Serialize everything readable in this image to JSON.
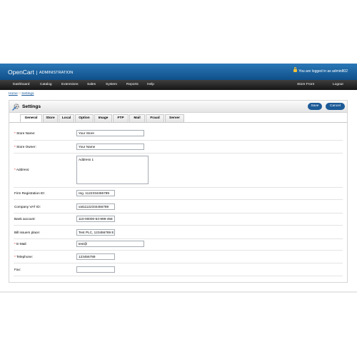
{
  "header": {
    "brand": "OpenCart",
    "subtitle": "ADMINISTRATION",
    "login_text": "You are logged in as admin802"
  },
  "menu": {
    "left": [
      "Dashboard",
      "Catalog",
      "Extensions",
      "Sales",
      "System",
      "Reports",
      "Help"
    ],
    "right": [
      "Store Front",
      "Logout"
    ]
  },
  "breadcrumb": {
    "home": "Home",
    "separator": "::",
    "current": "Settings"
  },
  "panel": {
    "title": "Settings",
    "save_label": "Save",
    "cancel_label": "Cancel"
  },
  "tabs": [
    "General",
    "Store",
    "Local",
    "Option",
    "Image",
    "FTP",
    "Mail",
    "Fraud",
    "Server"
  ],
  "active_tab": "General",
  "fields": [
    {
      "label": "Store Name:",
      "required": true,
      "value": "Your Store"
    },
    {
      "label": "Store Owner:",
      "required": true,
      "value": "Your Name"
    },
    {
      "label": "Address:",
      "required": true,
      "value": "Address 1"
    },
    {
      "label": "Firm Registration ID:",
      "required": false,
      "value": "reg. 1122334455789"
    },
    {
      "label": "Company VAT ID:",
      "required": false,
      "value": "vat11122334456789"
    },
    {
      "label": "Bank account:",
      "required": false,
      "value": "110-00000-53-999-458"
    },
    {
      "label": "Bill issuers place:",
      "required": false,
      "value": "Test PLC, 123456789 E"
    },
    {
      "label": "E-Mail:",
      "required": true,
      "value": "test@"
    },
    {
      "label": "Telephone:",
      "required": true,
      "value": "123456789"
    },
    {
      "label": "Fax:",
      "required": false,
      "value": ""
    }
  ],
  "colors": {
    "header_blue": "#1d64a3",
    "menu_dark": "#2a2a2a",
    "button_blue": "#1c5a97",
    "required_red": "#e00000"
  }
}
